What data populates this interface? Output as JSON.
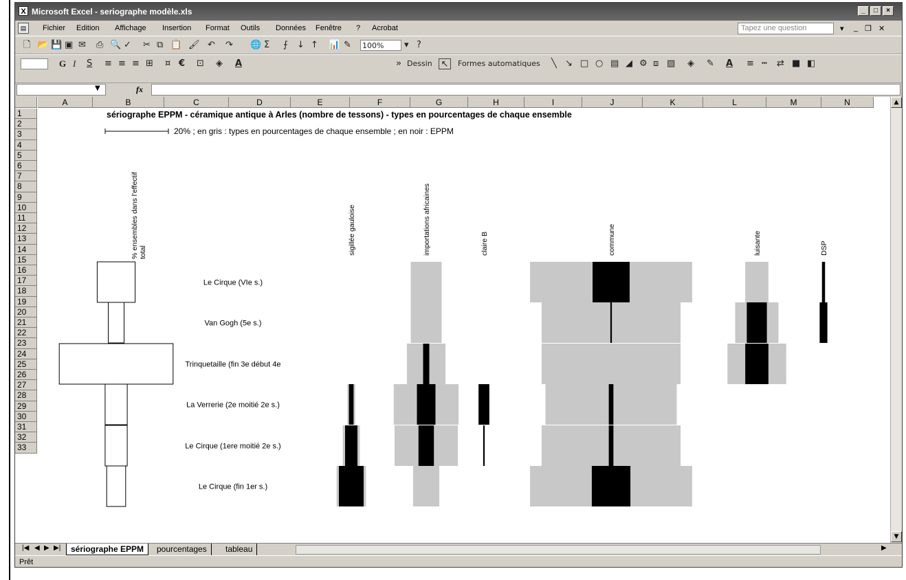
{
  "window": {
    "title": "Microsoft Excel - seriographe modèle.xls",
    "app_icon": "X"
  },
  "menu": {
    "items": [
      "Fichier",
      "Edition",
      "Affichage",
      "Insertion",
      "Format",
      "Outils",
      "Données",
      "Fenêtre",
      "?",
      "Acrobat"
    ],
    "ask_placeholder": "Tapez une question"
  },
  "toolbar": {
    "zoom": "100%",
    "drawing_label": "Dessin",
    "autoshapes_label": "Formes automatiques",
    "bold": "G",
    "italic": "I",
    "underline": "S",
    "euro": "€"
  },
  "formula_bar": {
    "fx": "fx",
    "name_box": "",
    "content": ""
  },
  "columns": [
    "A",
    "B",
    "C",
    "D",
    "E",
    "F",
    "G",
    "H",
    "I",
    "J",
    "K",
    "L",
    "M",
    "N"
  ],
  "rows": [
    "1",
    "2",
    "3",
    "4",
    "5",
    "6",
    "7",
    "8",
    "9",
    "10",
    "11",
    "12",
    "13",
    "14",
    "15",
    "16",
    "17",
    "18",
    "19",
    "20",
    "21",
    "22",
    "23",
    "24",
    "25",
    "26",
    "27",
    "28",
    "29",
    "30",
    "31",
    "32",
    "33"
  ],
  "sheet": {
    "title": "sériographe EPPM - céramique antique à Arles (nombre de tessons) - types en pourcentages de chaque ensemble",
    "legend": "20% ; en gris : types en pourcentages de chaque ensemble ; en noir : EPPM",
    "total_header": "% ensembles dans l'effectif total",
    "ensembles": [
      "Le Cirque (VIe s.)",
      "Van Gogh (5e s.)",
      "Trinquetaille (fin 3e début 4e",
      "La Verrerie (2e moitié 2e s.)",
      "Le Cirque (1ere moitié 2e s.)",
      "Le Cirque (fin 1er s.)"
    ],
    "types": [
      "sigillée gauloise",
      "importations africaines",
      "claire B",
      "commune",
      "luisante",
      "DSP"
    ]
  },
  "chart_data": {
    "type": "seriograph",
    "title": "sériographe EPPM - céramique antique à Arles (nombre de tessons) - types en pourcentages de chaque ensemble",
    "scale_note": "20%",
    "colors": {
      "percent": "#c8c8c8",
      "eppm": "#000000"
    },
    "totals": [
      12,
      5,
      36,
      7,
      7,
      6
    ],
    "types": [
      {
        "name": "sigillée gauloise",
        "percent": [
          0,
          0,
          0,
          5,
          11,
          19
        ],
        "eppm": [
          0,
          0,
          0,
          3,
          8,
          16
        ]
      },
      {
        "name": "importations africaines",
        "percent": [
          20,
          20,
          25,
          42,
          41,
          17
        ],
        "eppm": [
          0,
          0,
          4,
          12,
          10,
          0
        ]
      },
      {
        "name": "claire B",
        "percent": [
          0,
          0,
          0,
          0,
          0,
          0
        ],
        "eppm": [
          0,
          0,
          0,
          7,
          1,
          0
        ]
      },
      {
        "name": "commune",
        "percent": [
          105,
          90,
          90,
          85,
          90,
          105
        ],
        "eppm": [
          24,
          1,
          0,
          3,
          3,
          25
        ]
      },
      {
        "name": "luisante",
        "percent": [
          15,
          28,
          38,
          0,
          0,
          0
        ],
        "eppm": [
          0,
          13,
          15,
          0,
          0,
          0
        ]
      },
      {
        "name": "DSP",
        "percent": [
          0,
          0,
          0,
          0,
          0,
          0
        ],
        "eppm": [
          2,
          5,
          0,
          0,
          0,
          0
        ]
      }
    ]
  },
  "tabs": {
    "active": "sériographe EPPM",
    "others": [
      "pourcentages",
      "tableau"
    ]
  },
  "status": {
    "text": "Prêt"
  }
}
